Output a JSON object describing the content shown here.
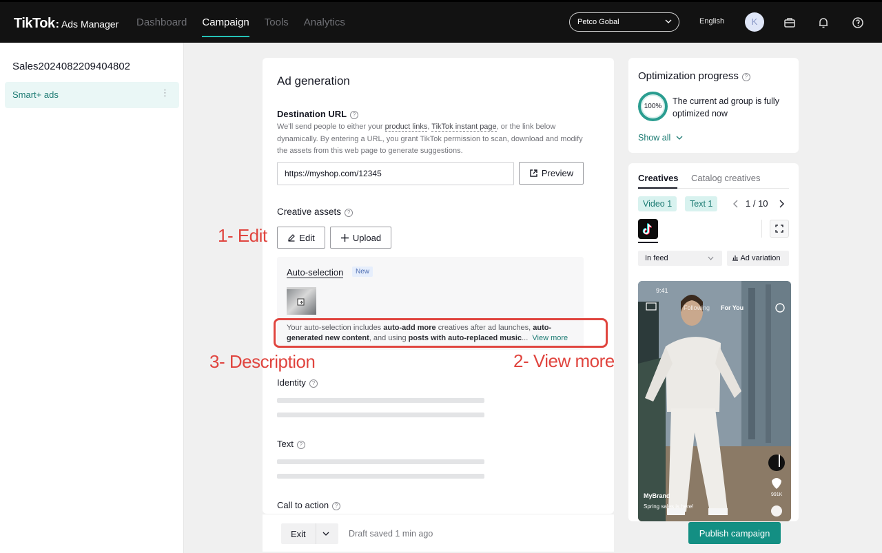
{
  "topbar": {
    "logo_brand": "TikTok",
    "logo_colon": ":",
    "logo_sub": "Ads Manager",
    "nav": [
      "Dashboard",
      "Campaign",
      "Tools",
      "Analytics"
    ],
    "active_nav": "Campaign",
    "account": "Petco Gobal",
    "language": "English",
    "avatar_initial": "K",
    "icons": [
      "briefcase-icon",
      "bell-icon",
      "help-icon"
    ]
  },
  "sidebar": {
    "campaign_name": "Sales2024082209404802",
    "item_label": "Smart+ ads",
    "item_more": "⋮"
  },
  "main": {
    "title": "Ad generation",
    "destination": {
      "label": "Destination URL",
      "desc_1": "We'll send people to either your ",
      "desc_link1": "product links",
      "desc_2": ", ",
      "desc_link2": "TikTok instant page",
      "desc_3": ", or the link below dynamically. By entering a URL, you grant TikTok permission to scan, download and modify the assets from this web page to generate suggestions.",
      "url_value": "https://myshop.com/12345",
      "preview_label": "Preview"
    },
    "creative": {
      "label": "Creative assets",
      "edit_label": "Edit",
      "upload_label": "Upload",
      "auto_title": "Auto-selection",
      "new_badge": "New",
      "desc_1": "Your auto-selection includes ",
      "bold_1": "auto-add more",
      "desc_2": " creatives after ad launches, ",
      "bold_2": "auto-generated new content",
      "desc_3": ", and using ",
      "bold_3": "posts with auto-replaced music",
      "desc_4": "...",
      "view_more": "View more"
    },
    "identity_label": "Identity",
    "text_label": "Text",
    "cta_label": "Call to action"
  },
  "footer": {
    "exit_label": "Exit",
    "draft_status": "Draft saved 1 min ago",
    "publish_label": "Publish campaign"
  },
  "optimization": {
    "title": "Optimization progress",
    "percent": "100%",
    "status": "The current ad group is fully optimized now",
    "show_all": "Show all"
  },
  "preview": {
    "tabs": [
      "Creatives",
      "Catalog creatives"
    ],
    "chips": [
      "Video 1",
      "Text 1"
    ],
    "pager": "1 / 10",
    "placement": "In feed",
    "ad_variation": "Ad variation",
    "phone": {
      "time": "9:41",
      "following": "Following",
      "for_you": "For You",
      "likes": "991K",
      "brand": "MyBrand",
      "caption": "Spring sales is here!"
    }
  },
  "annotations": {
    "edit": "1- Edit",
    "view_more": "2- View more",
    "description": "3- Description"
  },
  "colors": {
    "accent": "#138f83",
    "annotation": "#e0453f",
    "topbar": "#121212"
  }
}
